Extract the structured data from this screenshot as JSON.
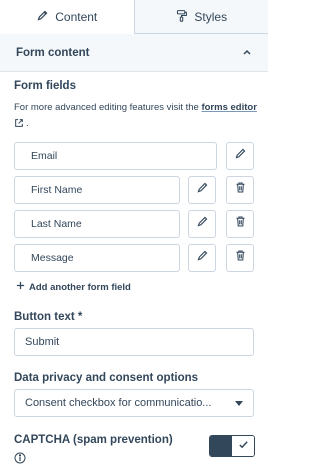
{
  "tabs": [
    {
      "label": "Content",
      "icon": "pencil-icon",
      "active": true
    },
    {
      "label": "Styles",
      "icon": "paint-roller-icon",
      "active": false
    }
  ],
  "section": {
    "title": "Form content",
    "icon": "chevron-up-icon"
  },
  "form_fields": {
    "heading": "Form fields",
    "help_prefix": "For more advanced editing features visit the",
    "help_link": "forms editor",
    "help_suffix": ".",
    "fields": [
      {
        "label": "Email",
        "removable": false
      },
      {
        "label": "First Name",
        "removable": true
      },
      {
        "label": "Last Name",
        "removable": true
      },
      {
        "label": "Message",
        "removable": true
      }
    ],
    "add_label": "Add another form field"
  },
  "button_text": {
    "label": "Button text *",
    "value": "Submit"
  },
  "privacy": {
    "label": "Data privacy and consent options",
    "selected": "Consent checkbox for communicatio..."
  },
  "captcha": {
    "label": "CAPTCHA (spam prevention)",
    "enabled": true
  },
  "colors": {
    "text": "#33475b",
    "border": "#cbd6e2",
    "panel": "#f5f8fa"
  }
}
